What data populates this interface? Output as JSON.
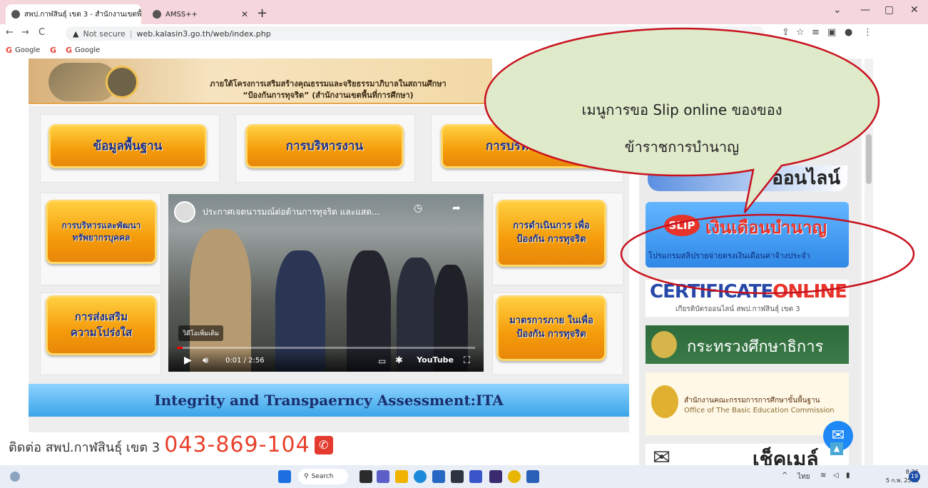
{
  "browser": {
    "tabs": [
      {
        "label": "สพป.กาฬสินธุ์ เขต 3 - สำนักงานเขตพื้",
        "active": true
      },
      {
        "label": "AMSS++",
        "active": false
      }
    ],
    "new_tab": "+",
    "url_prefix": "Not secure",
    "url": "web.kalasin3.go.th/web/index.php",
    "bookmarks": [
      "Google",
      "Google"
    ],
    "window_controls": [
      "⌄",
      "—",
      "▢",
      "✕"
    ]
  },
  "page": {
    "banner": {
      "line1": "ภายใต้โครงการเสริมสร้างคุณธรรมและจริยธรรมาภิบาลในสถานศึกษา",
      "line2": "“ป้องกันการทุจริต” (สำนักงานเขตพื้นที่การศึกษา)"
    },
    "menu_buttons": [
      "ข้อมูลพื้นฐาน",
      "การบริหารงาน",
      "การบริหารเงินฯ",
      "การบริหารและพัฒนา ทรัพยากรบุคคล",
      "การดำเนินการ เพื่อป้องกัน การทุจริต",
      "การส่งเสริม ความโปร่งใส",
      "มาตรการภาย ในเพื่อป้องกัน การทุจริต"
    ],
    "video": {
      "title": "ประกาศเจตนารมณ์ต่อต้านการทุจริต และแสด...",
      "more_videos": "วิดีโอเพิ่มเติม",
      "time": "0:01 / 2:56",
      "brand": "YouTube",
      "progress": 0.02
    },
    "ita_bar": "Integrity and Transpaerncy Assessment:ITA",
    "contact_label": "ติดต่อ สพป.กาฬสินธุ์ เขต 3",
    "contact_phone": "043-869-104",
    "sidebar": {
      "online_tail": "ออนไลน์",
      "slip_tag": "SLIP",
      "slip_title": "เงินเดือนบำนาญ",
      "slip_sub": "โปรแกรมสลิปรายจ่ายตรงเงินเดือนค่าจ้างประจำ",
      "cert_title_a": "CERTIFICATE",
      "cert_title_b": "ONLINE",
      "cert_sub": "เกียรติบัตรออนไลน์ สพป.กาฬสินธุ์ เขต 3",
      "moe": "กระทรวงศึกษาธิการ",
      "obec_th": "สำนักงานคณะกรรมการการศึกษาขั้นพื้นฐาน",
      "obec_en": "Office of The Basic Education Commission",
      "bottom_banner": "เช็คเมล์"
    }
  },
  "callout": {
    "line1": "เมนูการขอ Slip online ของของ",
    "line2": "ข้าราชการบำนาญ"
  },
  "taskbar": {
    "search": "Search",
    "lang": "ไทย",
    "time": "8:26",
    "date": "5 ก.พ. 2566",
    "notifications": "19"
  }
}
